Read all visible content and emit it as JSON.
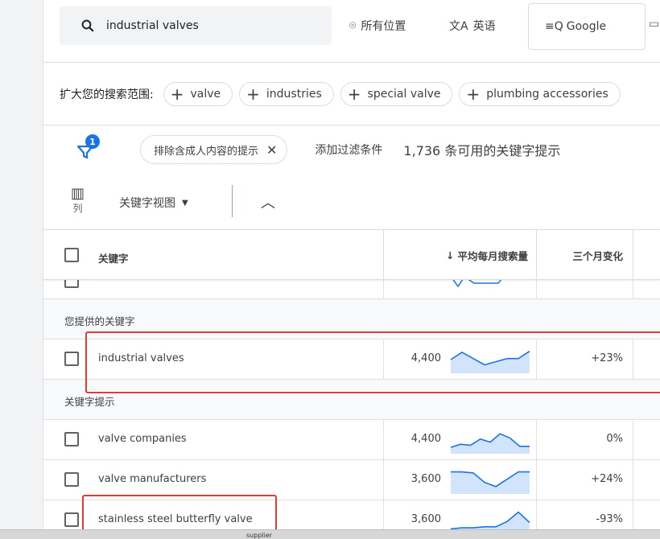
{
  "search": {
    "query": "industrial valves",
    "location": "所有位置",
    "language": "英语",
    "network": "Google"
  },
  "expand": {
    "label": "扩大您的搜索范围:",
    "chips": [
      "valve",
      "industries",
      "special valve",
      "plumbing accessories"
    ]
  },
  "filters": {
    "badge_count": "1",
    "active_chip": "排除含成人内容的提示",
    "add_filter": "添加过滤条件",
    "result_count": "1,736 条可用的关键字提示"
  },
  "view": {
    "columns_label": "列",
    "view_select": "关键字视图"
  },
  "table": {
    "headers": {
      "keyword": "关键字",
      "avg_monthly": "平均每月搜索量",
      "three_month_change": "三个月变化"
    },
    "section_provided": "您提供的关键字",
    "section_suggestions": "关键字提示",
    "provided_rows": [
      {
        "keyword": "industrial valves",
        "volume": "4,400",
        "change": "+23%",
        "trend": [
          0.5,
          0.15,
          0.45,
          0.75,
          0.6,
          0.45,
          0.45,
          0.1
        ]
      }
    ],
    "suggestion_rows": [
      {
        "keyword": "valve companies",
        "volume": "4,400",
        "change": "0%",
        "trend": [
          0.85,
          0.7,
          0.75,
          0.45,
          0.6,
          0.2,
          0.4,
          0.8,
          0.8
        ]
      },
      {
        "keyword": "valve manufacturers",
        "volume": "3,600",
        "change": "+24%",
        "trend": [
          0.1,
          0.1,
          0.15,
          0.6,
          0.8,
          0.45,
          0.1,
          0.1
        ]
      },
      {
        "keyword": "stainless steel butterfly valve",
        "volume": "3,600",
        "change": "-93%",
        "trend": [
          0.9,
          0.85,
          0.85,
          0.8,
          0.8,
          0.55,
          0.1,
          0.6
        ]
      }
    ]
  },
  "taskbar": {
    "label": "supplier"
  },
  "colors": {
    "accent": "#1a73e8",
    "highlight": "#e53935",
    "spark_fill": "#d2e3fc"
  }
}
